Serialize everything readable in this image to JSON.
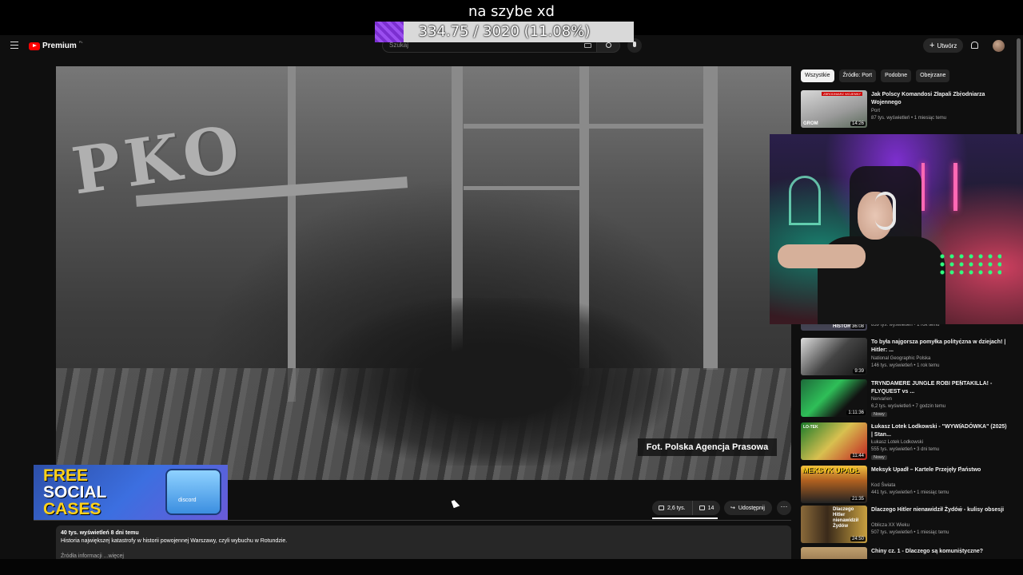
{
  "stream_overlay": {
    "title": "na szybe xd",
    "progress_text": "334.75 / 3020 (11.08%)",
    "progress_fraction": 0.1108,
    "progress_color": "#7b2fd0"
  },
  "header": {
    "brand": "Premium",
    "brand_sup": "PL",
    "search_placeholder": "Szukaj",
    "create_label": "Utwórz"
  },
  "player": {
    "sign_text": "PKO",
    "caption": "Fot. Polska Agencja Prasowa"
  },
  "ad": {
    "line1": "FREE",
    "line2": "SOCIAL",
    "line3": "CASES",
    "case_label": "discord"
  },
  "actions": {
    "likes": "2,6 tys.",
    "dislikes": "14",
    "share": "Udostępnij"
  },
  "description": {
    "meta": "40 tys. wyświetleń  8 dni temu",
    "text": "Historia największej katastrofy w historii powojennej Warszawy, czyli wybuchu w Rotundzie.",
    "more": "Źródła informacji ...więcej"
  },
  "chips": [
    "Wszystkie",
    "Źródło: Port",
    "Podobne",
    "Obejrzane"
  ],
  "recommendations": [
    {
      "title": "Jak Polscy Komandosi Złapali Zbrodniarza Wojennego",
      "channel": "Port",
      "stats": "87 tys. wyświetleń • 1 miesiąc temu",
      "duration": "14:26",
      "badge": ""
    },
    {
      "title": "",
      "channel": "",
      "stats": "839 tys. wyświetleń • 1 rok temu",
      "duration": "36:08",
      "badge": ""
    },
    {
      "title": "To była najgorsza pomyłka polityczna w dziejach! | Hitler: ...",
      "channel": "National Geographic Polska",
      "stats": "146 tys. wyświetleń • 1 rok temu",
      "duration": "9:39",
      "badge": ""
    },
    {
      "title": "TRYNDAMERE JUNGLE ROBI PENTAKILLA! - FLYQUEST vs ...",
      "channel": "Nervarien",
      "stats": "6,2 tys. wyświetleń • 7 godzin temu",
      "duration": "1:11:36",
      "badge": "Nowy"
    },
    {
      "title": "Łukasz Lotek Lodkowski - \"WYWIADÓWKA\" (2025) | Stan...",
      "channel": "Łukasz Lotek Lodkowski",
      "stats": "555 tys. wyświetleń • 3 dni temu",
      "duration": "11:44",
      "badge": "Nowy"
    },
    {
      "title": "Meksyk Upadł – Kartele Przejęły Państwo",
      "channel": "Kod Świata",
      "stats": "441 tys. wyświetleń • 1 miesiąc temu",
      "duration": "21:35",
      "badge": ""
    },
    {
      "title": "Dlaczego Hitler nienawidził Żydów - kulisy obsesji",
      "channel": "Oblicza XX Wieku",
      "stats": "507 tys. wyświetleń • 1 miesiąc temu",
      "duration": "24:50",
      "badge": ""
    },
    {
      "title": "Chiny cz. 1 - Dlaczego są komunistyczne?",
      "channel": "",
      "stats": "",
      "duration": "",
      "badge": ""
    }
  ],
  "thumb_texts": {
    "t1_label": "ZBRODNIARZ WOJENNY",
    "t1_brand": "GROM",
    "t2_label": "HISTORIE",
    "t5_label": "LO-TEK",
    "t6_label": "MEKSYK UPADŁ",
    "t7_label": "Dlaczego Hitler nienawidził Żydów"
  }
}
